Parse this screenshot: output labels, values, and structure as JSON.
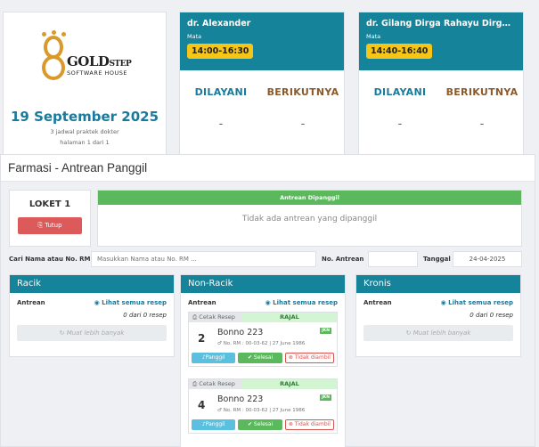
{
  "logo": {
    "brand": "GOLD",
    "brand_suffix": "STEP",
    "sub": "SOFTWARE HOUSE"
  },
  "header": {
    "date": "19 September 2025",
    "schedule_info": "3 jadwal praktek dokter",
    "page_info": "halaman 1 dari 1"
  },
  "doctors": [
    {
      "name": "dr. Alexander",
      "mata_label": "Mata",
      "time": "14:00-16:30",
      "served_label": "DILAYANI",
      "next_label": "BERIKUTNYA",
      "served_value": "-",
      "next_value": "-"
    },
    {
      "name": "dr. Gilang Dirga Rahayu Dirgan...",
      "mata_label": "Mata",
      "time": "14:40-16:40",
      "served_label": "DILAYANI",
      "next_label": "BERIKUTNYA",
      "served_value": "-",
      "next_value": "-"
    }
  ],
  "page_title": "Farmasi - Antrean Panggil",
  "loket": {
    "title": "LOKET 1",
    "close_button": "Tutup"
  },
  "called": {
    "header": "Antrean Dipanggil",
    "empty_text": "Tidak ada antrean yang dipanggil"
  },
  "search": {
    "name_label": "Cari Nama atau No. RM",
    "name_placeholder": "Masukkan Nama atau No. RM ...",
    "queue_label": "No. Antrean",
    "date_label": "Tanggal",
    "date_value": "24-04-2025"
  },
  "columns": {
    "racik": {
      "title": "Racik",
      "queue_label": "Antrean",
      "see_all": "Lihat semua resep",
      "count": "0 dari 0 resep",
      "load_more": "Muat lebih banyak"
    },
    "non_racik": {
      "title": "Non-Racik",
      "queue_label": "Antrean",
      "see_all": "Lihat semua resep"
    },
    "kronis": {
      "title": "Kronis",
      "queue_label": "Antrean",
      "see_all": "Lihat semua resep",
      "count": "0 dari 0 resep",
      "load_more": "Muat lebih banyak"
    }
  },
  "prescriptions": [
    {
      "print_label": "Cetak Resep",
      "type": "RAJAL",
      "number": "2",
      "name": "Bonno 223",
      "meta": "No. RM : 00-03-62 | 27 June 1986",
      "badge": "JKN",
      "call": "Panggil",
      "done": "Selesai",
      "not_taken": "Tidak diambil"
    },
    {
      "print_label": "Cetak Resep",
      "type": "RAJAL",
      "number": "4",
      "name": "Bonno 223",
      "meta": "No. RM : 00-03-62 | 27 June 1986",
      "badge": "JKN",
      "call": "Panggil",
      "done": "Selesai",
      "not_taken": "Tidak diambil"
    }
  ]
}
